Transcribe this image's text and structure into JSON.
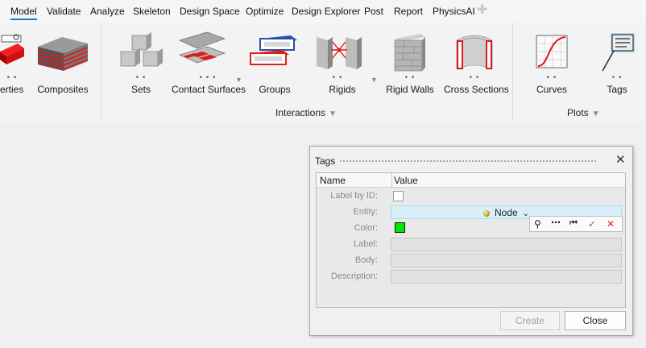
{
  "menu": {
    "tabs": [
      "Model",
      "Validate",
      "Analyze",
      "Skeleton",
      "Design Space",
      "Optimize",
      "Design Explorer",
      "Post",
      "Report",
      "PhysicsAI"
    ],
    "active": "Model",
    "add_icon": "plus-icon"
  },
  "ribbon": {
    "tools": {
      "properties": "erties",
      "composites": "Composites",
      "sets": "Sets",
      "contact_surfaces": "Contact Surfaces",
      "groups": "Groups",
      "rigids": "Rigids",
      "rigid_walls": "Rigid Walls",
      "cross_sections": "Cross Sections",
      "curves": "Curves",
      "tags": "Tags"
    },
    "dots": "• •",
    "dots3": "• • •",
    "groups": {
      "interactions": "Interactions",
      "plots": "Plots"
    }
  },
  "dialog": {
    "title": "Tags",
    "columns": {
      "name": "Name",
      "value": "Value"
    },
    "rows": {
      "label_by_id": "Label by ID:",
      "entity": "Entity:",
      "color": "Color:",
      "label": "Label:",
      "body": "Body:",
      "description": "Description:"
    },
    "entity_value": "Node",
    "label_by_id_checked": false,
    "color_value": "#00e600",
    "buttons": {
      "create": "Create",
      "close": "Close"
    }
  }
}
